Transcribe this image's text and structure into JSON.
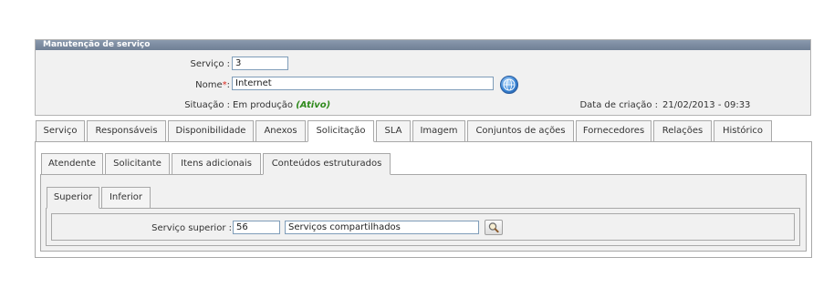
{
  "panel": {
    "title": "Manutenção de serviço",
    "servico_label": "Serviço :",
    "servico_value": "3",
    "nome_label": "Nome",
    "nome_required": "*",
    "nome_colon": ":",
    "nome_value": "Internet",
    "situacao_label": "Situação :",
    "situacao_text": "Em produção",
    "situacao_status": "(Ativo)",
    "data_criacao_label": "Data de criação :",
    "data_criacao_value": "21/02/2013 - 09:33"
  },
  "main_tabs": [
    "Serviço",
    "Responsáveis",
    "Disponibilidade",
    "Anexos",
    "Solicitação",
    "SLA",
    "Imagem",
    "Conjuntos de ações",
    "Fornecedores",
    "Relações",
    "Histórico"
  ],
  "main_tabs_active": "Solicitação",
  "sub_tabs": [
    "Atendente",
    "Solicitante",
    "Itens adicionais",
    "Conteúdos estruturados"
  ],
  "sub_tabs_active": "Conteúdos estruturados",
  "inner_tabs": [
    "Superior",
    "Inferior"
  ],
  "inner_tabs_active": "Superior",
  "superior": {
    "label": "Serviço superior :",
    "code_value": "56",
    "name_value": "Serviços compartilhados"
  },
  "colors": {
    "title_bar": "#7b8a9e",
    "required": "#d9281f",
    "active_status": "#2f8a1c"
  },
  "icons": {
    "lookup": "globe-icon",
    "search": "magnifier-icon"
  }
}
